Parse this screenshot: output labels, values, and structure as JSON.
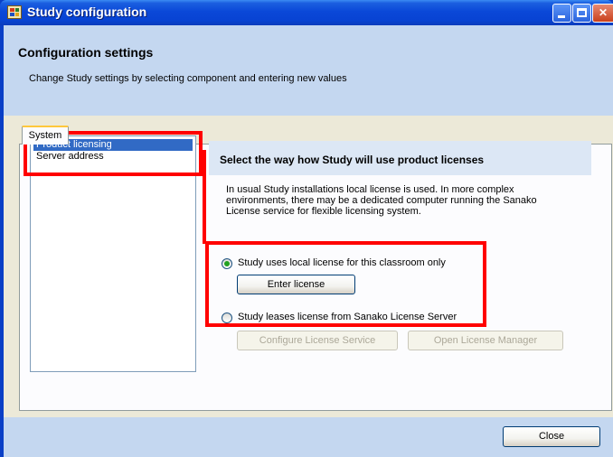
{
  "window": {
    "title": "Study configuration"
  },
  "header": {
    "title": "Configuration settings",
    "subtitle": "Change Study settings by selecting component and entering new values"
  },
  "tabs": [
    {
      "label": "System",
      "selected": true
    }
  ],
  "component_list": {
    "items": [
      {
        "label": "Product licensing",
        "selected": true
      },
      {
        "label": "Server address",
        "selected": false
      }
    ]
  },
  "licensing": {
    "section_title": "Select the way how Study will use product licenses",
    "description": "In usual Study installations local license is used. In more complex environments, there may be a dedicated computer running the Sanako License service for flexible licensing system.",
    "options": [
      {
        "label": "Study uses local license for this classroom only",
        "checked": true
      },
      {
        "label": "Study leases license from Sanako License Server",
        "checked": false
      }
    ],
    "enter_license_label": "Enter license",
    "configure_service_label": "Configure License Service",
    "open_manager_label": "Open License Manager"
  },
  "footer": {
    "close_label": "Close"
  },
  "colors": {
    "titlebar": "#0a48d8",
    "header_bg": "#c4d7f0",
    "selection": "#316ac5",
    "highlight": "#ff0000"
  }
}
